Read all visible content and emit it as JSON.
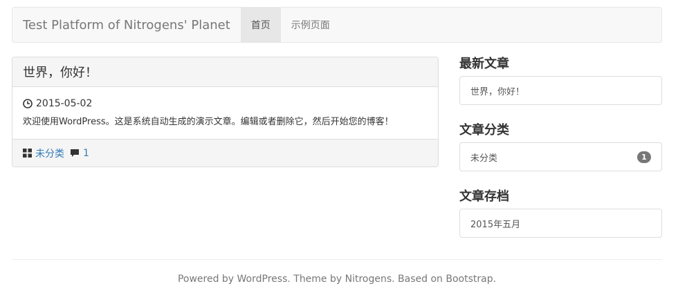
{
  "navbar": {
    "brand": "Test Platform of Nitrogens' Planet",
    "items": [
      {
        "label": "首页",
        "active": true
      },
      {
        "label": "示例页面",
        "active": false
      }
    ]
  },
  "post": {
    "title": "世界，你好！",
    "date": "2015-05-02",
    "excerpt": "欢迎使用WordPress。这是系统自动生成的演示文章。编辑或者删除它，然后开始您的博客！",
    "category": "未分类",
    "comments": "1"
  },
  "sidebar": {
    "recent": {
      "title": "最新文章",
      "items": [
        "世界，你好！"
      ]
    },
    "categories": {
      "title": "文章分类",
      "items": [
        {
          "label": "未分类",
          "count": "1"
        }
      ]
    },
    "archives": {
      "title": "文章存档",
      "items": [
        "2015年五月"
      ]
    }
  },
  "footer": {
    "text": "Powered by WordPress. Theme by Nitrogens. Based on Bootstrap."
  },
  "colors": {
    "link": "#337ab7",
    "muted": "#777777",
    "panel_bg": "#f5f5f5",
    "nav_active_bg": "#e7e7e7"
  }
}
